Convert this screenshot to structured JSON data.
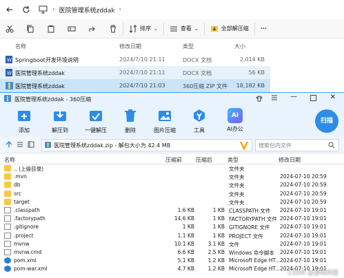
{
  "explorer": {
    "breadcrumb": "医院管理系统zddak",
    "toolbar": {
      "sort_label": "排序",
      "view_label": "查看",
      "extract_all_label": "全部解压缩",
      "more_label": "···"
    },
    "columns": {
      "name": "名称",
      "modified": "修改日期",
      "type": "类型",
      "size": "大小"
    },
    "files": [
      {
        "name": "Springboot开发环境说明",
        "modified": "2024/7/10 21:11",
        "type": "DOCX 文档",
        "size": "2,014 KB",
        "icon": "word-doc-icon"
      },
      {
        "name": "医院管理系统zddak",
        "modified": "2024/7/10 21:11",
        "type": "DOCX 文档",
        "size": "56 KB",
        "icon": "word-doc-icon"
      },
      {
        "name": "医院管理系统zddak",
        "modified": "2024/7/10 21:03",
        "type": "360压缩 ZIP 文件",
        "size": "18,182 KB",
        "icon": "zip-archive-icon"
      }
    ]
  },
  "zip": {
    "title": "医院管理系统zddak - 360压缩",
    "scan_label": "扫描",
    "tools": [
      {
        "label": "添加",
        "icon": "add-icon"
      },
      {
        "label": "解压到",
        "icon": "extract-to-icon"
      },
      {
        "label": "一键解压",
        "icon": "one-click-extract-icon"
      },
      {
        "label": "删除",
        "icon": "delete-icon"
      },
      {
        "label": "图片压缩",
        "icon": "image-compress-icon"
      },
      {
        "label": "工具",
        "icon": "tools-icon"
      },
      {
        "label": "AI办公",
        "icon": "ai-office-icon"
      }
    ],
    "ai_badge": "AI",
    "path": "医院管理系统zddak.zip - 解包大小为 42.4 MB",
    "search_placeholder": "搜索包内文件",
    "columns": {
      "name": "名称",
      "compressed": "压缩前",
      "compressed_after": "压缩后",
      "type": "类型",
      "modified": "修改日期"
    },
    "rows": [
      {
        "name": ".. (上级目录)",
        "before": "",
        "after": "",
        "type": "文件夹",
        "date": "",
        "icon": "folder"
      },
      {
        "name": ".mvn",
        "before": "",
        "after": "",
        "type": "文件夹",
        "date": "2024-07-10 20:59",
        "icon": "folder"
      },
      {
        "name": "db",
        "before": "",
        "after": "",
        "type": "文件夹",
        "date": "2024-07-10 20:59",
        "icon": "folder"
      },
      {
        "name": "src",
        "before": "",
        "after": "",
        "type": "文件夹",
        "date": "2024-07-10 20:59",
        "icon": "folder"
      },
      {
        "name": "target",
        "before": "",
        "after": "",
        "type": "文件夹",
        "date": "2024-07-10 20:59",
        "icon": "folder"
      },
      {
        "name": ".classpath",
        "before": "1.6 KB",
        "after": "1 KB",
        "type": "CLASSPATH 文件",
        "date": "2024-07-10 19:01",
        "icon": "doc"
      },
      {
        "name": ".factorypath",
        "before": "14.6 KB",
        "after": "1 KB",
        "type": "FACTORYPATH 文件",
        "date": "2024-07-10 19:01",
        "icon": "doc"
      },
      {
        "name": ".gitignore",
        "before": "1 KB",
        "after": "1 KB",
        "type": "GITIGNORE 文件",
        "date": "2024-07-10 19:01",
        "icon": "doc"
      },
      {
        "name": ".project",
        "before": "1.1 KB",
        "after": "1 KB",
        "type": "PROJECT 文件",
        "date": "2024-07-10 19:01",
        "icon": "doc"
      },
      {
        "name": "mvnw",
        "before": "10.1 KB",
        "after": "3.1 KB",
        "type": "文件",
        "date": "2024-07-10 19:01",
        "icon": "doc"
      },
      {
        "name": "mvnw.cmd",
        "before": "6.6 KB",
        "after": "2.5 KB",
        "type": "Windows 命令脚本",
        "date": "2024-07-10 19:01",
        "icon": "doc"
      },
      {
        "name": "pom.xml",
        "before": "5.1 KB",
        "after": "1.2 KB",
        "type": "Microsoft Edge HT...",
        "date": "2024-07-10 19:01",
        "icon": "xml"
      },
      {
        "name": "pom-war.xml",
        "before": "4.7 KB",
        "after": "1.2 KB",
        "type": "Microsoft Edge HT...",
        "date": "2024-07-10 19:01",
        "icon": "xml"
      }
    ],
    "watermark": "CSDN @源码科技"
  }
}
